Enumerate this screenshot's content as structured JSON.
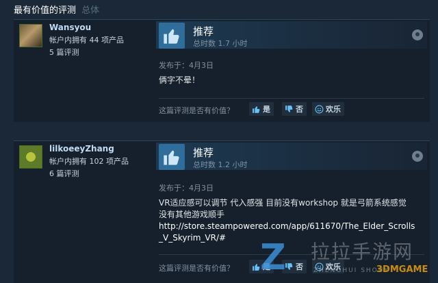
{
  "header": {
    "title": "最有价值的评测",
    "subtitle": "总体"
  },
  "reviews": [
    {
      "author": "Wansyou",
      "owned": "帐户内拥有 44 项产品",
      "count": "5 篇评测",
      "recommendation": "推荐",
      "hours": "总时数 1.7 小时",
      "posted": "发布于：4月3日",
      "body": [
        "俩字不晕！"
      ],
      "helpful_prompt": "这篇评测是否有价值？",
      "yes": "是",
      "no": "否",
      "funny": "欢乐"
    },
    {
      "author": "lilkoeeyZhang",
      "owned": "帐户内拥有 102 项产品",
      "count": "6 篇评测",
      "recommendation": "推荐",
      "hours": "总时数 1.2 小时",
      "posted": "发布于：4月3日",
      "body": [
        "VR适应感可以调节 代入感强 目前没有workshop 就是弓箭系统感觉",
        "没有其他游戏顺手",
        "http://store.steampowered.com/app/611670/The_Elder_Scrolls",
        "_V_Skyrim_VR/#"
      ],
      "helpful_prompt": "这篇评测是否有价值？",
      "yes": "是",
      "no": "否",
      "funny": "欢乐"
    }
  ],
  "watermark": {
    "letter": "Z",
    "chinese": "拉拉手游网",
    "english": "ZHENGHUI SHOUY",
    "brand": "3DMGAME"
  },
  "icons": {
    "thumb": "thumbs-up-icon",
    "steam": "steam-icon",
    "vote_up": "thumbs-up-icon",
    "vote_down": "thumbs-down-icon",
    "funny": "smiley-icon"
  },
  "colors": {
    "background": "#1b2838",
    "link": "#67c1f5",
    "thumb": "#2f6d9a"
  }
}
